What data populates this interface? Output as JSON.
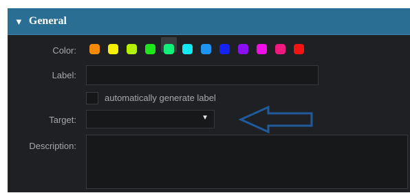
{
  "section": {
    "title": "General",
    "caret": "▼"
  },
  "color": {
    "label": "Color:",
    "options": [
      {
        "name": "orange",
        "hex": "#f58a06"
      },
      {
        "name": "yellow",
        "hex": "#f7ef00"
      },
      {
        "name": "yellow-green",
        "hex": "#b4f100"
      },
      {
        "name": "green",
        "hex": "#1ee51c"
      },
      {
        "name": "spring-green",
        "hex": "#12f07c"
      },
      {
        "name": "cyan",
        "hex": "#12eaf2"
      },
      {
        "name": "azure",
        "hex": "#1f95f3"
      },
      {
        "name": "blue",
        "hex": "#1422f4"
      },
      {
        "name": "violet",
        "hex": "#8a0ff2"
      },
      {
        "name": "magenta",
        "hex": "#f00fe7"
      },
      {
        "name": "pink",
        "hex": "#f0197f"
      },
      {
        "name": "red",
        "hex": "#f21313"
      }
    ],
    "selected": "spring-green"
  },
  "label_field": {
    "label": "Label:",
    "value": ""
  },
  "auto_label": {
    "text": "automatically generate label",
    "checked": false
  },
  "target": {
    "label": "Target:",
    "value": "",
    "caret": "▼"
  },
  "description": {
    "label": "Description:",
    "value": ""
  },
  "annotation": {
    "arrow_color": "#1f5b9c",
    "direction": "left"
  }
}
